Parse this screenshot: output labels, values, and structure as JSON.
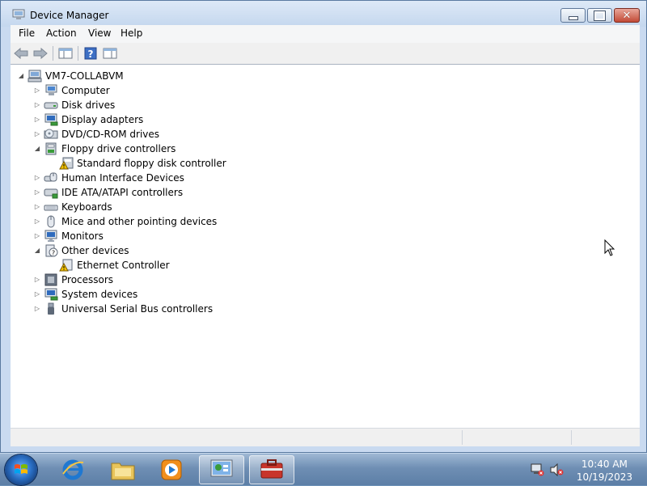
{
  "window": {
    "title": "Device Manager"
  },
  "menu": [
    "File",
    "Action",
    "View",
    "Help"
  ],
  "toolbar": {
    "buttons": [
      "back-icon",
      "forward-icon",
      "show-hide-console-tree-icon",
      "help-icon",
      "properties-view-icon"
    ]
  },
  "tree": {
    "root": "VM7-COLLABVM",
    "items": [
      {
        "label": "Computer",
        "expanded": false,
        "icon": "computer-icon"
      },
      {
        "label": "Disk drives",
        "expanded": false,
        "icon": "disk-drive-icon"
      },
      {
        "label": "Display adapters",
        "expanded": false,
        "icon": "display-adapter-icon"
      },
      {
        "label": "DVD/CD-ROM drives",
        "expanded": false,
        "icon": "dvd-drive-icon"
      },
      {
        "label": "Floppy drive controllers",
        "expanded": true,
        "icon": "floppy-controller-icon",
        "children": [
          {
            "label": "Standard floppy disk controller",
            "icon": "warning-device-icon"
          }
        ]
      },
      {
        "label": "Human Interface Devices",
        "expanded": false,
        "icon": "hid-icon"
      },
      {
        "label": "IDE ATA/ATAPI controllers",
        "expanded": false,
        "icon": "ide-controller-icon"
      },
      {
        "label": "Keyboards",
        "expanded": false,
        "icon": "keyboard-icon"
      },
      {
        "label": "Mice and other pointing devices",
        "expanded": false,
        "icon": "mouse-icon"
      },
      {
        "label": "Monitors",
        "expanded": false,
        "icon": "monitor-icon"
      },
      {
        "label": "Other devices",
        "expanded": true,
        "icon": "unknown-device-icon",
        "children": [
          {
            "label": "Ethernet Controller",
            "icon": "warning-device-icon"
          }
        ]
      },
      {
        "label": "Processors",
        "expanded": false,
        "icon": "processor-icon"
      },
      {
        "label": "System devices",
        "expanded": false,
        "icon": "system-devices-icon"
      },
      {
        "label": "Universal Serial Bus controllers",
        "expanded": false,
        "icon": "usb-icon"
      }
    ]
  },
  "taskbar": {
    "pinned": [
      "internet-explorer-icon",
      "windows-explorer-icon",
      "media-player-icon",
      "control-panel-icon",
      "device-manager-task-icon"
    ],
    "active_index": 4,
    "clock": {
      "time": "10:40 AM",
      "date": "10/19/2023"
    }
  },
  "colors": {
    "selection": "#3399ff",
    "warning": "#f2c200"
  }
}
